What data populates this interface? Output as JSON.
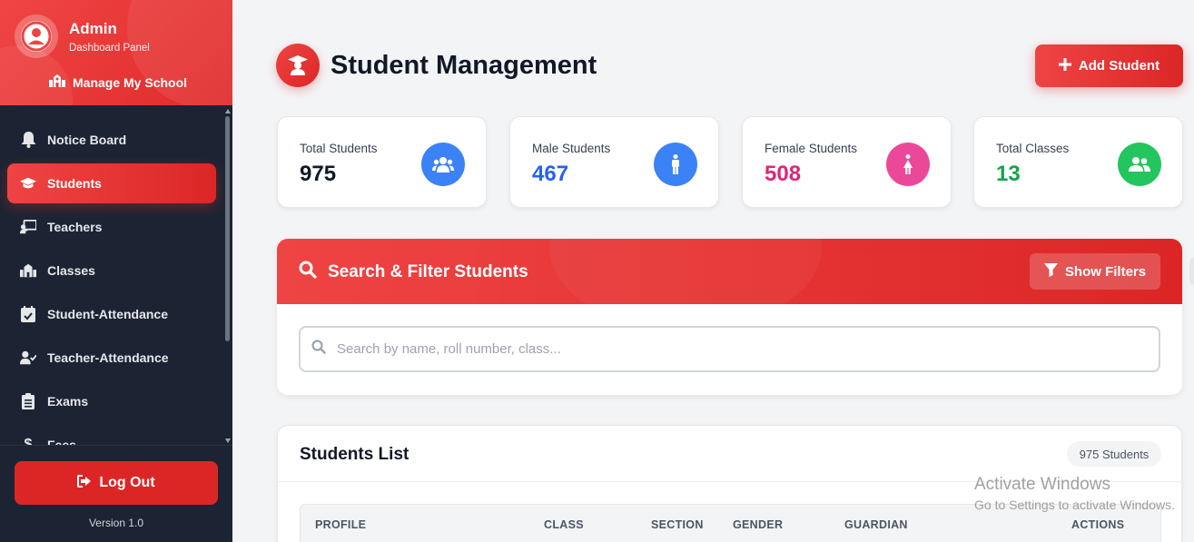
{
  "sidebar": {
    "admin_name": "Admin",
    "admin_subtitle": "Dashboard Panel",
    "manage_label": "Manage My School",
    "items": [
      {
        "label": "Notice Board",
        "icon": "bell-icon",
        "active": false
      },
      {
        "label": "Students",
        "icon": "graduation-cap-icon",
        "active": true
      },
      {
        "label": "Teachers",
        "icon": "chalkboard-teacher-icon",
        "active": false
      },
      {
        "label": "Classes",
        "icon": "school-icon",
        "active": false
      },
      {
        "label": "Student-Attendance",
        "icon": "calendar-check-icon",
        "active": false
      },
      {
        "label": "Teacher-Attendance",
        "icon": "user-check-icon",
        "active": false
      },
      {
        "label": "Exams",
        "icon": "clipboard-list-icon",
        "active": false
      },
      {
        "label": "Fees",
        "icon": "dollar-icon",
        "active": false
      }
    ],
    "logout_label": "Log Out",
    "version": "Version 1.0"
  },
  "header": {
    "title": "Student Management",
    "add_button": "Add Student"
  },
  "stats": [
    {
      "label": "Total Students",
      "value": "975",
      "color": "#111827",
      "icon": "users-icon",
      "icon_bg": "#3b82f6"
    },
    {
      "label": "Male Students",
      "value": "467",
      "color": "#2563eb",
      "icon": "male-icon",
      "icon_bg": "#3b82f6"
    },
    {
      "label": "Female Students",
      "value": "508",
      "color": "#db2777",
      "icon": "female-icon",
      "icon_bg": "#ec4899"
    },
    {
      "label": "Total Classes",
      "value": "13",
      "color": "#16a34a",
      "icon": "user-group-icon",
      "icon_bg": "#22c55e"
    }
  ],
  "search": {
    "title": "Search & Filter Students",
    "filter_button": "Show Filters",
    "placeholder": "Search by name, roll number, class..."
  },
  "students_list": {
    "title": "Students List",
    "count_badge": "975 Students",
    "columns": [
      "PROFILE",
      "CLASS",
      "SECTION",
      "GENDER",
      "GUARDIAN",
      "ACTIONS"
    ]
  },
  "watermark": {
    "line1": "Activate Windows",
    "line2": "Go to Settings to activate Windows."
  },
  "colors": {
    "accent": "#dc2626",
    "sidebar_bg": "#1c2433"
  }
}
